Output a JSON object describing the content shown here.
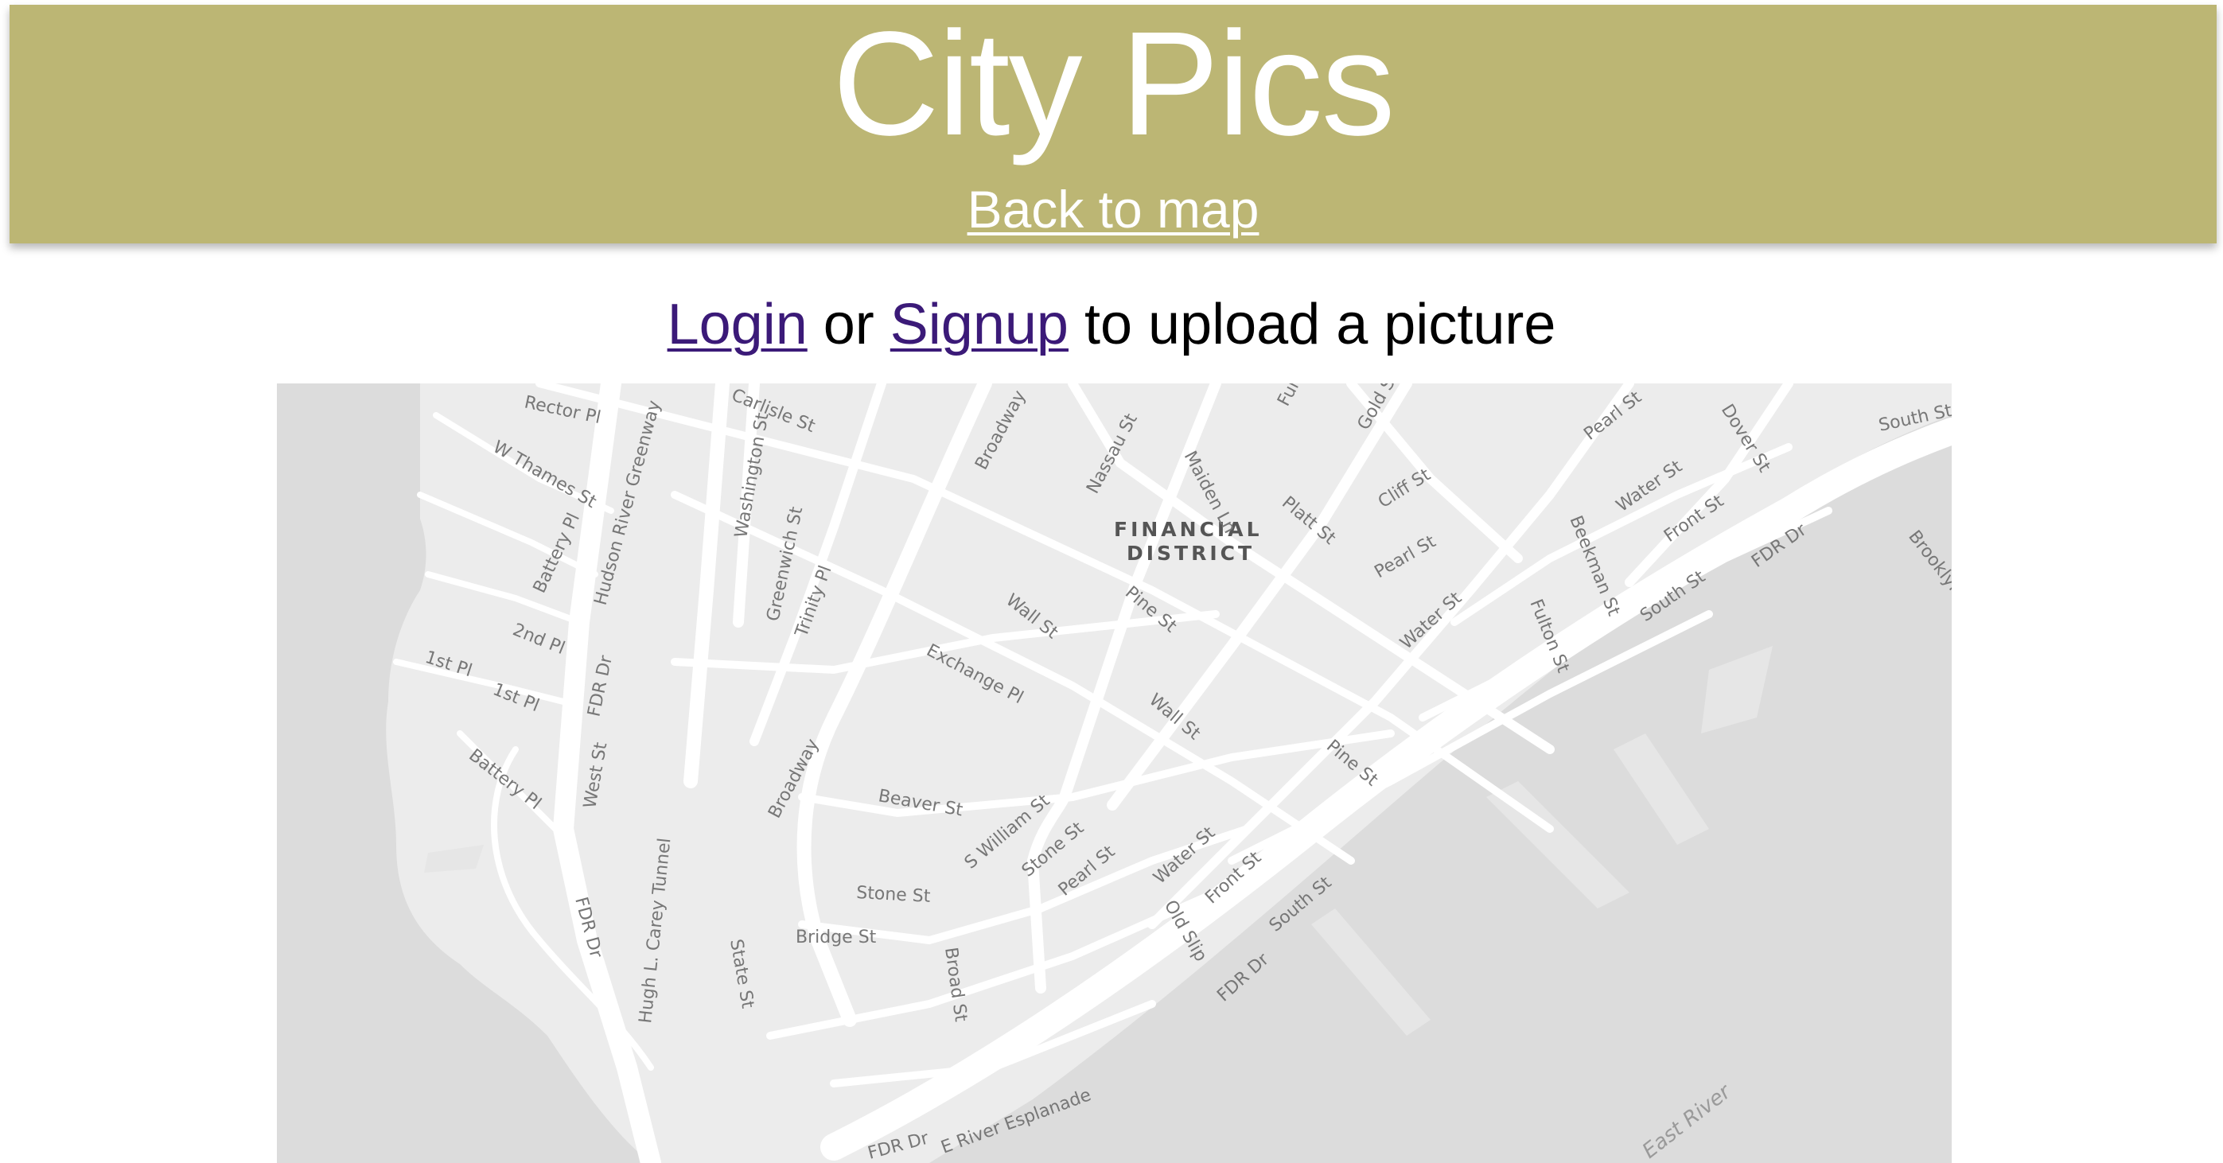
{
  "header": {
    "title": "City Pics",
    "back_link": "Back to map",
    "background_color": "#bcb674"
  },
  "auth": {
    "login_label": "Login",
    "or_text": " or ",
    "signup_label": "Signup",
    "suffix_text": " to upload a picture"
  },
  "map": {
    "district_line1": "FINANCIAL",
    "district_line2": "DISTRICT",
    "streets": [
      "Rector Pl",
      "Carlisle St",
      "Broadway",
      "Nassau St",
      "Maiden Ln",
      "Fulton St",
      "Gold St",
      "Pearl St",
      "Dover St",
      "South St",
      "W Thames St",
      "Washington St",
      "Greenwich St",
      "Battery Pl",
      "Hudson River Greenway",
      "2nd Pl",
      "1st Pl",
      "1st Pl",
      "FDR Dr",
      "Trinity Pl",
      "Wall St",
      "Pine St",
      "Exchange Pl",
      "Platt St",
      "Cliff St",
      "Pearl St",
      "Water St",
      "Beekman St",
      "Water St",
      "Front St",
      "South St",
      "FDR Dr",
      "Brooklyn",
      "Fulton St",
      "Wall St",
      "Pine St",
      "Battery Pl",
      "West St",
      "Broadway",
      "Beaver St",
      "S William St",
      "Stone St",
      "Pearl St",
      "Water St",
      "Front St",
      "South St",
      "Stone St",
      "Bridge St",
      "Old Slip",
      "FDR Dr",
      "Hugh L. Carey Tunnel",
      "FDR Dr",
      "State St",
      "Broad St",
      "E River Esplanade",
      "FDR Dr",
      "East River"
    ]
  }
}
